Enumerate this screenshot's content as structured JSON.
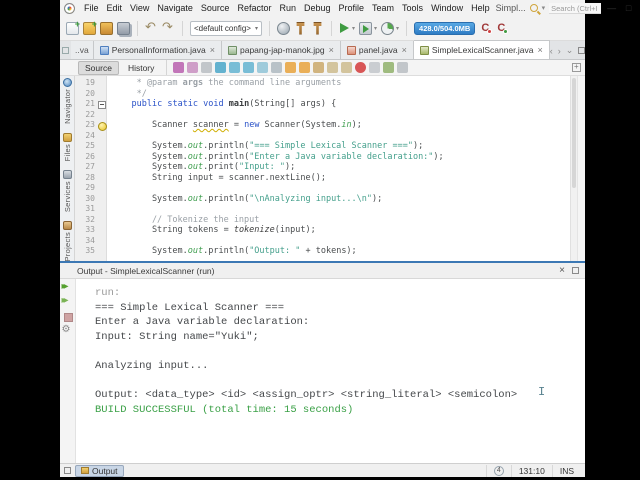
{
  "window": {
    "title_truncated": "Simpl...",
    "search_placeholder": "Search (Ctrl+I",
    "minimize": "—",
    "maximize": "□",
    "close": "×"
  },
  "menubar": {
    "items": [
      "File",
      "Edit",
      "View",
      "Navigate",
      "Source",
      "Refactor",
      "Run",
      "Debug",
      "Profile",
      "Team",
      "Tools",
      "Window",
      "Help"
    ]
  },
  "toolbar": {
    "icon_groups": [
      [
        "new-file",
        "new-project",
        "open-project",
        "save-all"
      ],
      [
        "undo",
        "redo"
      ],
      [
        "config"
      ],
      [
        "web",
        "build-project",
        "clean-build-project"
      ],
      [
        "run-project",
        "debug-project",
        "profile-project"
      ]
    ],
    "config_value": "<default config>",
    "memory": "428.0/504.0MB"
  },
  "tabs": {
    "stub_label": "..va",
    "close_glyph": "×",
    "items": [
      {
        "label": "PersonalInformation.java",
        "icon": "java-file-icon",
        "active": false
      },
      {
        "label": "papang-jap-manok.jpg",
        "icon": "image-file-icon",
        "active": false
      },
      {
        "label": "panel.java",
        "icon": "form-file-icon",
        "active": false
      },
      {
        "label": "SimpleLexicalScanner.java",
        "icon": "java-main-file-icon",
        "active": true
      }
    ]
  },
  "editor_toolbar": {
    "source_label": "Source",
    "history_label": "History",
    "icon_names": [
      "last-edit",
      "back",
      "forward",
      "find-selection",
      "find-next",
      "find-previous",
      "toggle-highlight",
      "select-in-projects",
      "previous-bookmark",
      "next-bookmark",
      "toggle-bookmark",
      "shift-left",
      "shift-right",
      "record-macro",
      "stop-macro",
      "comment",
      "uncomment"
    ]
  },
  "sidebar": {
    "items": [
      {
        "label": "Navigator",
        "icon": "navigator-icon"
      },
      {
        "label": "Files",
        "icon": "files-icon"
      },
      {
        "label": "Services",
        "icon": "services-icon"
      },
      {
        "label": "Projects",
        "icon": "projects-icon"
      }
    ]
  },
  "editor": {
    "lines": [
      {
        "n": "19",
        "seg": [
          {
            "t": "     * @param ",
            "c": "c"
          },
          {
            "t": "args",
            "c": "cb"
          },
          {
            "t": " the command line arguments",
            "c": "c"
          }
        ]
      },
      {
        "n": "20",
        "seg": [
          {
            "t": "     */",
            "c": "c"
          }
        ]
      },
      {
        "n": "21",
        "fold": true,
        "seg": [
          {
            "t": "    ",
            "c": "d"
          },
          {
            "t": "public",
            "c": "k"
          },
          {
            "t": " ",
            "c": "d"
          },
          {
            "t": "static",
            "c": "k"
          },
          {
            "t": " ",
            "c": "d"
          },
          {
            "t": "void",
            "c": "k"
          },
          {
            "t": " ",
            "c": "d"
          },
          {
            "t": "main",
            "c": "b"
          },
          {
            "t": "(String[] args) {",
            "c": "d"
          }
        ]
      },
      {
        "n": "22",
        "seg": []
      },
      {
        "n": "23",
        "bulb": true,
        "seg": [
          {
            "t": "        Scanner ",
            "c": "d"
          },
          {
            "t": "scanner",
            "c": "w"
          },
          {
            "t": " = ",
            "c": "d"
          },
          {
            "t": "new",
            "c": "k"
          },
          {
            "t": " Scanner(System.",
            "c": "d"
          },
          {
            "t": "in",
            "c": "f"
          },
          {
            "t": ");",
            "c": "d"
          }
        ]
      },
      {
        "n": "24",
        "seg": []
      },
      {
        "n": "25",
        "seg": [
          {
            "t": "        System.",
            "c": "d"
          },
          {
            "t": "out",
            "c": "f"
          },
          {
            "t": ".println(",
            "c": "d"
          },
          {
            "t": "\"=== Simple Lexical Scanner ===\"",
            "c": "s"
          },
          {
            "t": ");",
            "c": "d"
          }
        ]
      },
      {
        "n": "26",
        "seg": [
          {
            "t": "        System.",
            "c": "d"
          },
          {
            "t": "out",
            "c": "f"
          },
          {
            "t": ".println(",
            "c": "d"
          },
          {
            "t": "\"Enter a Java variable declaration:\"",
            "c": "s"
          },
          {
            "t": ");",
            "c": "d"
          }
        ]
      },
      {
        "n": "27",
        "seg": [
          {
            "t": "        System.",
            "c": "d"
          },
          {
            "t": "out",
            "c": "f"
          },
          {
            "t": ".print(",
            "c": "d"
          },
          {
            "t": "\"Input: \"",
            "c": "s"
          },
          {
            "t": ");",
            "c": "d"
          }
        ]
      },
      {
        "n": "28",
        "seg": [
          {
            "t": "        String input = scanner.nextLine();",
            "c": "d"
          }
        ]
      },
      {
        "n": "29",
        "seg": []
      },
      {
        "n": "30",
        "seg": [
          {
            "t": "        System.",
            "c": "d"
          },
          {
            "t": "out",
            "c": "f"
          },
          {
            "t": ".println(",
            "c": "d"
          },
          {
            "t": "\"\\nAnalyzing input...\\n\"",
            "c": "s"
          },
          {
            "t": ");",
            "c": "d"
          }
        ]
      },
      {
        "n": "31",
        "seg": []
      },
      {
        "n": "32",
        "seg": [
          {
            "t": "        // Tokenize the input",
            "c": "c"
          }
        ]
      },
      {
        "n": "33",
        "seg": [
          {
            "t": "        String tokens = ",
            "c": "d"
          },
          {
            "t": "tokenize",
            "c": "m"
          },
          {
            "t": "(input);",
            "c": "d"
          }
        ]
      },
      {
        "n": "34",
        "seg": []
      },
      {
        "n": "35",
        "seg": [
          {
            "t": "        System.",
            "c": "d"
          },
          {
            "t": "out",
            "c": "f"
          },
          {
            "t": ".println(",
            "c": "d"
          },
          {
            "t": "\"Output: \"",
            "c": "s"
          },
          {
            "t": " + tokens);",
            "c": "d"
          }
        ]
      }
    ]
  },
  "output": {
    "header_title": "Output - SimpleLexicalScanner (run)",
    "close_glyph": "×",
    "tool_icons": [
      "rerun",
      "rerun-debug",
      "stop",
      "ant-settings"
    ],
    "lines": [
      {
        "t": "run:",
        "c": "dim"
      },
      {
        "t": "=== Simple Lexical Scanner ===",
        "c": "std"
      },
      {
        "t": "Enter a Java variable declaration:",
        "c": "std"
      },
      {
        "t": "Input: String name=\"Yuki\";",
        "c": "std"
      },
      {
        "t": "",
        "c": "std"
      },
      {
        "t": "Analyzing input...",
        "c": "std"
      },
      {
        "t": "",
        "c": "std"
      },
      {
        "t": "Output: <data_type> <id> <assign_optr> <string_literal> <semicolon>",
        "c": "std"
      },
      {
        "t": "BUILD SUCCESSFUL (total time: 15 seconds)",
        "c": "ok"
      }
    ],
    "caret_glyph": "I"
  },
  "statusbar": {
    "output_tab": "Output",
    "notification_count": "4",
    "caret_position": "131:10",
    "insert_mode": "INS"
  }
}
